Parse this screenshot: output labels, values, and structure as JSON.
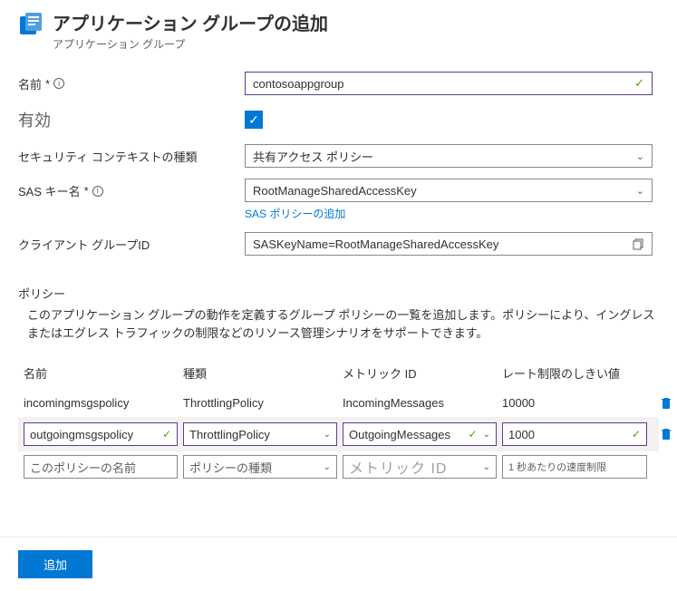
{
  "header": {
    "title": "アプリケーション グループの追加",
    "subtitle": "アプリケーション グループ"
  },
  "fields": {
    "name": {
      "label": "名前",
      "required": "*",
      "value": "contosoappgroup"
    },
    "enabled": {
      "label": "有効",
      "checked": true
    },
    "securityContext": {
      "label": "セキュリティ コンテキストの種類",
      "value": "共有アクセス ポリシー"
    },
    "sasKeyName": {
      "label": "SAS キー名",
      "required": "*",
      "value": "RootManageSharedAccessKey",
      "link": "SAS ポリシーの追加"
    },
    "clientGroup": {
      "label": "クライアント グループID",
      "value": "SASKeyName=RootManageSharedAccessKey"
    }
  },
  "policySection": {
    "heading": "ポリシー",
    "description": "このアプリケーション グループの動作を定義するグループ ポリシーの一覧を追加します。ポリシーにより、イングレスまたはエグレス トラフィックの制限などのリソース管理シナリオをサポートできます。",
    "columns": {
      "name": "名前",
      "type": "種類",
      "metric": "メトリック ID",
      "threshold": "レート制限のしきい値"
    },
    "rows": [
      {
        "name": "incomingmsgspolicy",
        "type": "ThrottlingPolicy",
        "metric": "IncomingMessages",
        "threshold": "10000"
      }
    ],
    "editingRow": {
      "name": "outgoingmsgspolicy",
      "type": "ThrottlingPolicy",
      "metric": "OutgoingMessages",
      "threshold": "1000"
    },
    "newRow": {
      "namePlaceholder": "このポリシーの名前",
      "typePlaceholder": "ポリシーの種類",
      "metricPlaceholder": "メトリック ID",
      "thresholdPlaceholder": "1 秒あたりの速度制限"
    }
  },
  "footer": {
    "addButton": "追加"
  }
}
